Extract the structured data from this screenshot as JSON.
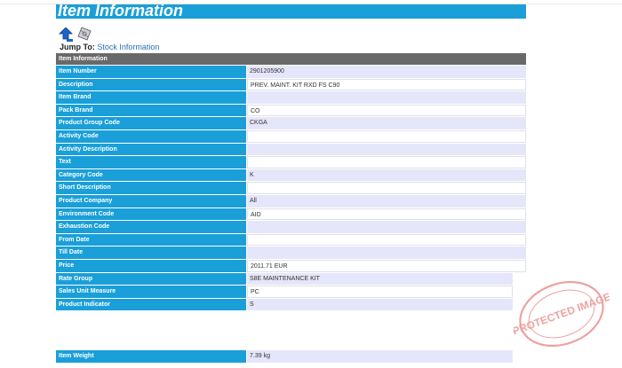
{
  "page": {
    "title": "Item Information"
  },
  "jump": {
    "label": "Jump To:",
    "link": "Stock Information"
  },
  "icons": {
    "up": "arrow-up-icon",
    "stock": "gears-icon"
  },
  "table": {
    "header": "Item Information",
    "rows": [
      {
        "label": "Item Number",
        "value": "2901205900"
      },
      {
        "label": "Description",
        "value": "PREV. MAINT. KIT RXD FS C90"
      },
      {
        "label": "Item Brand",
        "value": ""
      },
      {
        "label": "Pack Brand",
        "value": "CO"
      },
      {
        "label": "Product Group Code",
        "value": "CKGA"
      },
      {
        "label": "Activity Code",
        "value": ""
      },
      {
        "label": "Activity Description",
        "value": ""
      },
      {
        "label": "Text",
        "value": ""
      },
      {
        "label": "Category Code",
        "value": "K"
      },
      {
        "label": "Short Description",
        "value": ""
      },
      {
        "label": "Product Company",
        "value": "All"
      },
      {
        "label": "Environment Code",
        "value": "AID"
      },
      {
        "label": "Exhaustion Code",
        "value": ""
      },
      {
        "label": "From Date",
        "value": ""
      },
      {
        "label": "Till Date",
        "value": ""
      },
      {
        "label": "Price",
        "value": "2011.71 EUR"
      },
      {
        "label": "Rate Group",
        "value": "S8E MAINTENANCE KIT"
      },
      {
        "label": "Sales Unit Measure",
        "value": "PC"
      },
      {
        "label": "Product Indicator",
        "value": "S"
      }
    ],
    "weight": {
      "label": "Item Weight",
      "value": "7.39 kg"
    }
  },
  "stamp": {
    "text": "PROTECTED IMAGE"
  },
  "colors": {
    "accent": "#1a9fd8",
    "header_bg": "#696969",
    "alt_row": "#e6e6fa",
    "stamp": "#e05555"
  }
}
